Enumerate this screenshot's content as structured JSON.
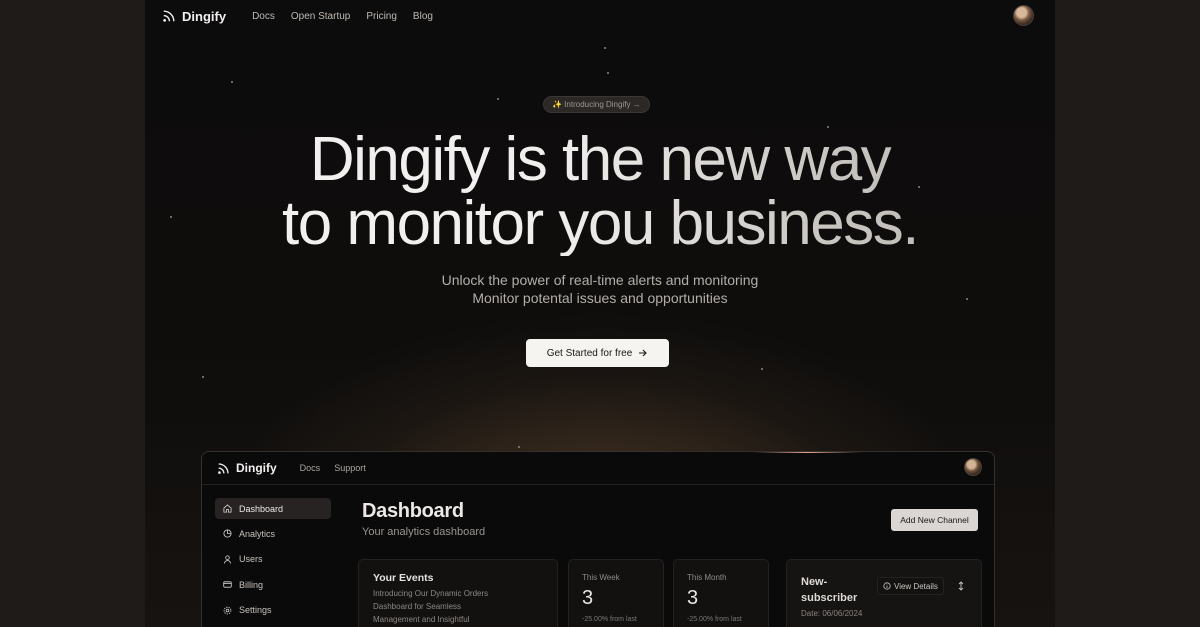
{
  "nav": {
    "brand": "Dingify",
    "links": [
      "Docs",
      "Open Startup",
      "Pricing",
      "Blog"
    ]
  },
  "hero": {
    "badge": "✨ Introducing Dingify →",
    "title_line1": "Dingify is the new way",
    "title_line2": "to monitor you business.",
    "sub_line1": "Unlock the power of real-time alerts and monitoring",
    "sub_line2": "Monitor potental issues and opportunities",
    "cta": "Get Started for free"
  },
  "app": {
    "brand": "Dingify",
    "links": [
      "Docs",
      "Support"
    ],
    "sidebar": [
      {
        "label": "Dashboard",
        "icon": "home-icon"
      },
      {
        "label": "Analytics",
        "icon": "chart-pie-icon"
      },
      {
        "label": "Users",
        "icon": "user-icon"
      },
      {
        "label": "Billing",
        "icon": "credit-card-icon"
      },
      {
        "label": "Settings",
        "icon": "gear-icon"
      }
    ],
    "title": "Dashboard",
    "subtitle": "Your analytics dashboard",
    "add_button": "Add New Channel",
    "events": {
      "title": "Your Events",
      "description": "Introducing Our Dynamic Orders Dashboard for Seamless Management and Insightful Analysis."
    },
    "stats": [
      {
        "label": "This Week",
        "value": "3",
        "change": "-25.00% from last"
      },
      {
        "label": "This Month",
        "value": "3",
        "change": "-25.00% from last"
      }
    ],
    "subscriber": {
      "title": "New-subscriber",
      "date": "Date: 06/06/2024",
      "view_button": "View Details"
    }
  },
  "colors": {
    "background": "#0d0c0c",
    "cta_bg": "#f6f4f1",
    "glow": "#78583a"
  }
}
